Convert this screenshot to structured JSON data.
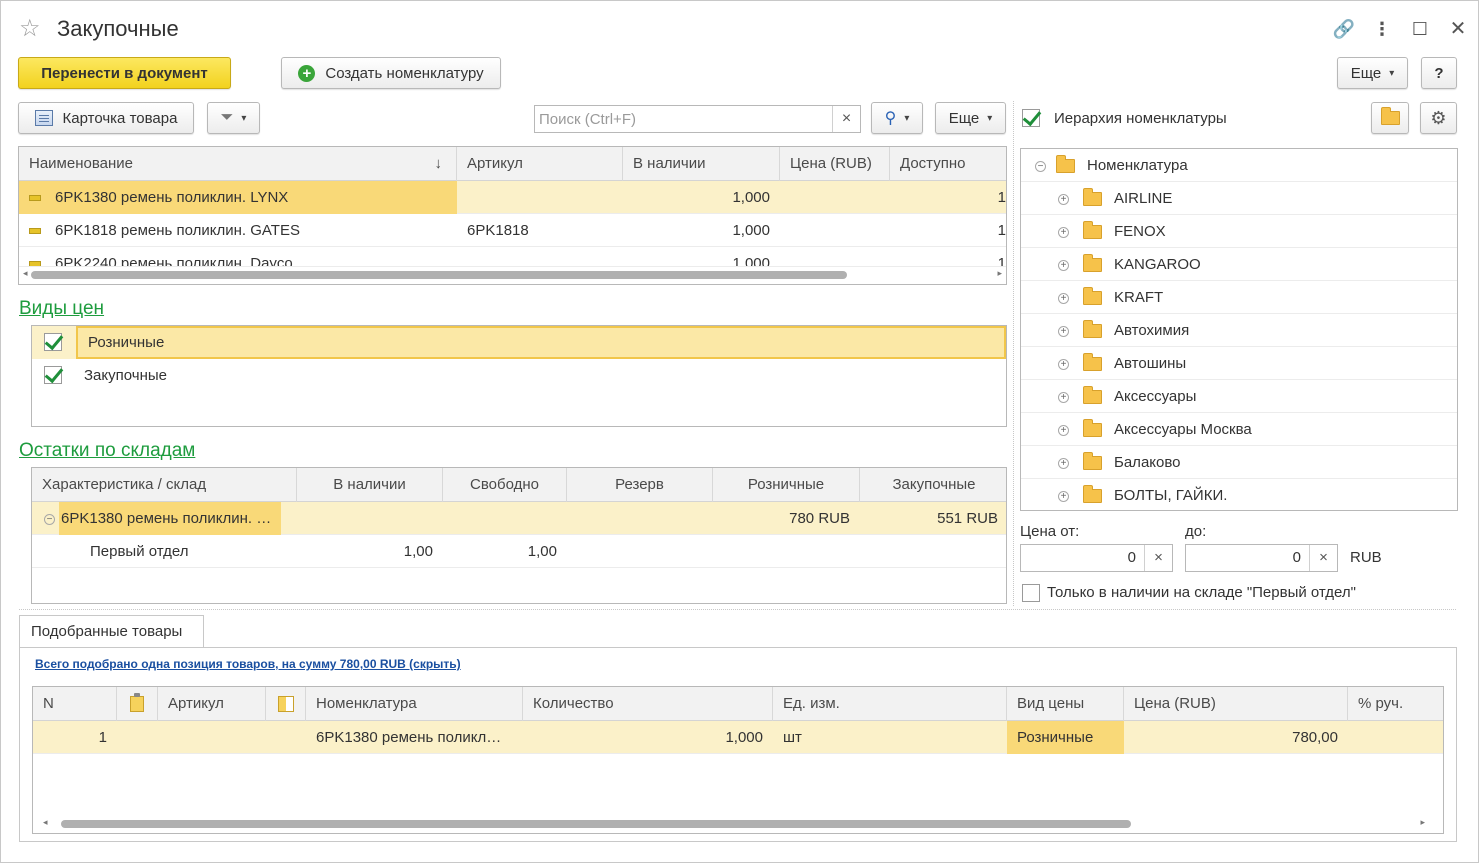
{
  "window": {
    "title": "Закупочные",
    "star_icon": "star-icon",
    "controls": [
      "link-icon",
      "more-vertical-icon",
      "maximize-icon",
      "close-icon"
    ]
  },
  "toolbar": {
    "transfer_label": "Перенести в документ",
    "create_label": "Создать номенклатуру",
    "more_label": "Еще",
    "help_label": "?"
  },
  "list_toolbar": {
    "card_label": "Карточка товара",
    "search_placeholder": "Поиск (Ctrl+F)",
    "search_clear": "×",
    "more_label": "Еще"
  },
  "products": {
    "columns": [
      "Наименование",
      "Артикул",
      "В наличии",
      "Цена (RUB)",
      "Доступно"
    ],
    "sort_indicator": "↓",
    "rows": [
      {
        "name": "6PK1380 ремень поликлин. LYNX",
        "article": "",
        "stock": "1,000",
        "price": "",
        "avail": "1"
      },
      {
        "name": "6PK1818  ремень поликлин. GATES",
        "article": "6PK1818",
        "stock": "1,000",
        "price": "",
        "avail": "1"
      },
      {
        "name": "6PK2240  ремень поликлин. Dayco",
        "article": "",
        "stock": "1,000",
        "price": "",
        "avail": "1"
      }
    ]
  },
  "price_types": {
    "title": "Виды цен",
    "items": [
      {
        "label": "Розничные",
        "checked": true
      },
      {
        "label": "Закупочные",
        "checked": true
      }
    ]
  },
  "warehouses": {
    "title": "Остатки по складам",
    "columns": [
      "Характеристика / склад",
      "В наличии",
      "Свободно",
      "Резерв",
      "Розничные",
      "Закупочные"
    ],
    "rows": [
      {
        "name": "6PK1380 ремень поликлин. …",
        "stock": "",
        "free": "",
        "reserve": "",
        "retail": "780 RUB",
        "purchase": "551 RUB"
      },
      {
        "name": "Первый отдел",
        "stock": "1,00",
        "free": "1,00",
        "reserve": "",
        "retail": "",
        "purchase": ""
      }
    ]
  },
  "hierarchy": {
    "label": "Иерархия номенклатуры",
    "checked": true,
    "root": "Номенклатура",
    "items": [
      "AIRLINE",
      "FENOX",
      "KANGAROO",
      "KRAFT",
      "Автохимия",
      "Автошины",
      "Аксессуары",
      "Аксессуары Москва",
      "Балаково",
      "БОЛТЫ, ГАЙКИ."
    ]
  },
  "price_filter": {
    "from_label": "Цена от:",
    "to_label": "до:",
    "from_value": "0",
    "to_value": "0",
    "clear": "×",
    "currency": "RUB",
    "only_in_stock_label": "Только в наличии на складе \"Первый отдел\""
  },
  "selected": {
    "tab_label": "Подобранные товары",
    "summary": "Всего подобрано одна позиция товаров, на сумму 780,00 RUB (скрыть)",
    "columns": [
      "N",
      "",
      "Артикул",
      "",
      "Номенклатура",
      "Количество",
      "Ед. изм.",
      "Вид цены",
      "Цена (RUB)",
      "% руч."
    ],
    "rows": [
      {
        "n": "1",
        "article": "",
        "name": "6PK1380 ремень поликл…",
        "qty": "1,000",
        "unit": "шт",
        "price_type": "Розничные",
        "price": "780,00",
        "manual": ""
      }
    ]
  }
}
